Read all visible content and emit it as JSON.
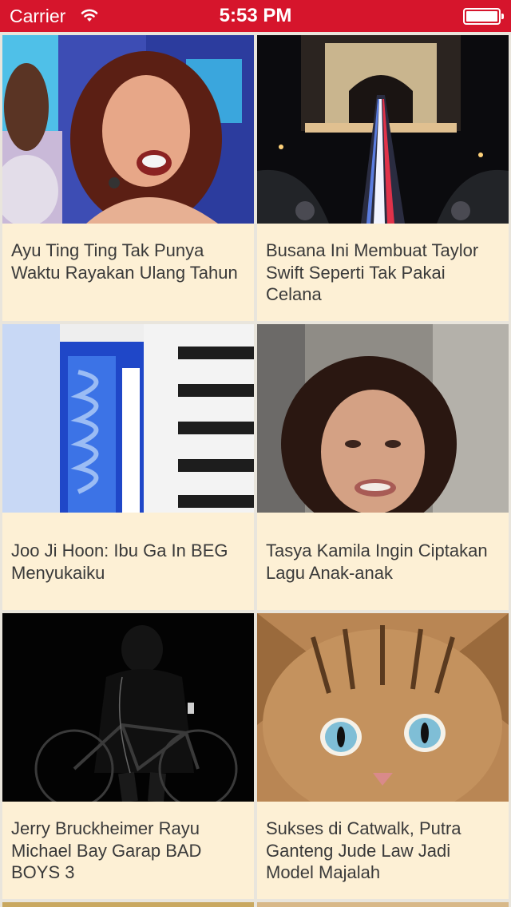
{
  "status_bar": {
    "carrier": "Carrier",
    "time": "5:53 PM"
  },
  "cards": [
    {
      "title": "Ayu Ting Ting Tak Punya Waktu Rayakan Ulang Tahun"
    },
    {
      "title": "Busana Ini Membuat Taylor Swift Seperti Tak Pakai Celana"
    },
    {
      "title": "Joo Ji Hoon: Ibu Ga In BEG Menyukaiku"
    },
    {
      "title": "Tasya Kamila Ingin Ciptakan Lagu Anak-anak"
    },
    {
      "title": "Jerry Bruckheimer Rayu Michael Bay Garap BAD BOYS 3"
    },
    {
      "title": "Sukses di Catwalk, Putra Ganteng Jude Law Jadi Model Majalah"
    }
  ],
  "colors": {
    "status_bar": "#d6152c",
    "card_background": "#fdf0d5",
    "grid_gap": "#e9e5dc",
    "title_text": "#3a3a3a"
  }
}
